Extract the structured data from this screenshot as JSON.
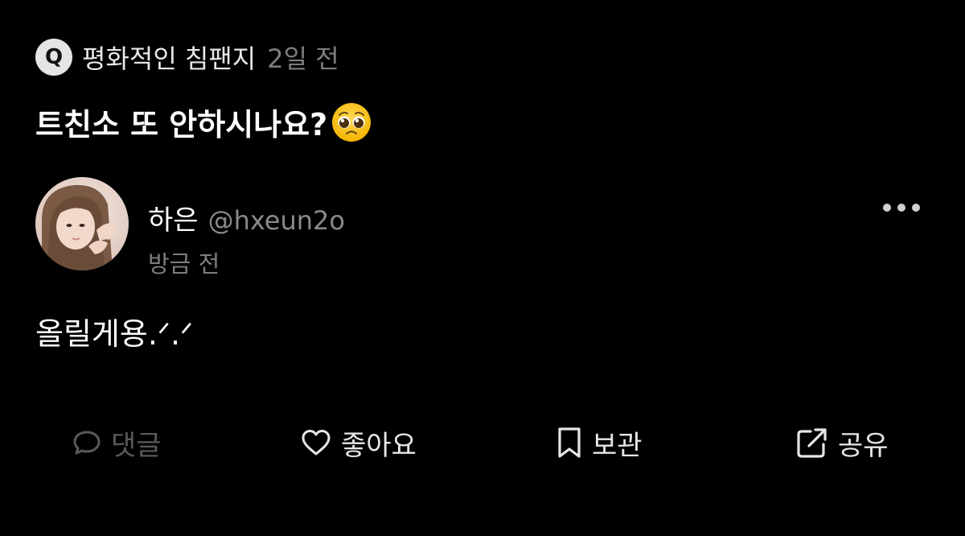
{
  "question": {
    "badge_letter": "Q",
    "asker_name": "평화적인 침팬지",
    "asked_time": "2일 전",
    "text": "트친소 또 안하시나요?",
    "emoji": "pleading-face-icon"
  },
  "answer": {
    "author_name": "하은",
    "author_handle": "@hxeun2o",
    "time": "방금 전",
    "text": "올릴게용.ᐟ.ᐟ"
  },
  "actions": {
    "comment_label": "댓글",
    "like_label": "좋아요",
    "save_label": "보관",
    "share_label": "공유"
  },
  "icons": {
    "comment": "speech-bubble-icon",
    "like": "heart-icon",
    "save": "bookmark-icon",
    "share": "share-arrow-icon",
    "more": "more-dots-icon"
  },
  "colors": {
    "background": "#000000",
    "primary_text": "#ffffff",
    "secondary_text": "#7d7d7d",
    "disabled_action": "#5a5a5a",
    "badge_bg": "#e5e5e5"
  }
}
